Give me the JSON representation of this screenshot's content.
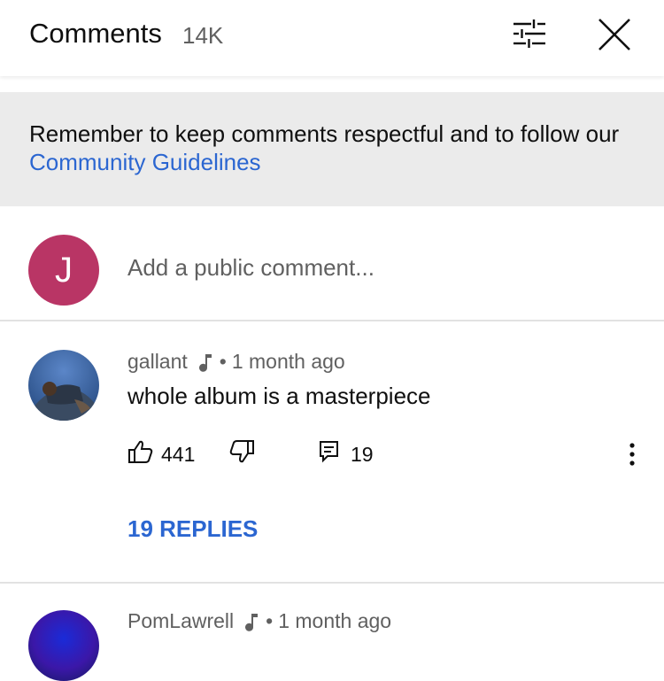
{
  "header": {
    "title": "Comments",
    "count": "14K"
  },
  "banner": {
    "text": "Remember to keep comments respectful and to follow our ",
    "link": "Community Guidelines"
  },
  "composer": {
    "avatar_letter": "J",
    "placeholder": "Add a public comment..."
  },
  "comments": [
    {
      "author": "gallant",
      "separator": "•",
      "time": "1 month ago",
      "text": "whole album is a masterpiece",
      "likes": "441",
      "reply_count": "19",
      "replies_label": "19 REPLIES"
    },
    {
      "author": "PomLawrell",
      "separator": "•",
      "time": "1 month ago"
    }
  ],
  "icons": {
    "filter": "filter-icon",
    "close": "close-icon",
    "music": "music-note-icon",
    "like": "thumbs-up-icon",
    "dislike": "thumbs-down-icon",
    "reply": "reply-icon",
    "more": "more-vertical-icon"
  },
  "colors": {
    "link": "#2b66d1",
    "avatar_me": "#b93565",
    "banner_bg": "#ebebeb"
  }
}
